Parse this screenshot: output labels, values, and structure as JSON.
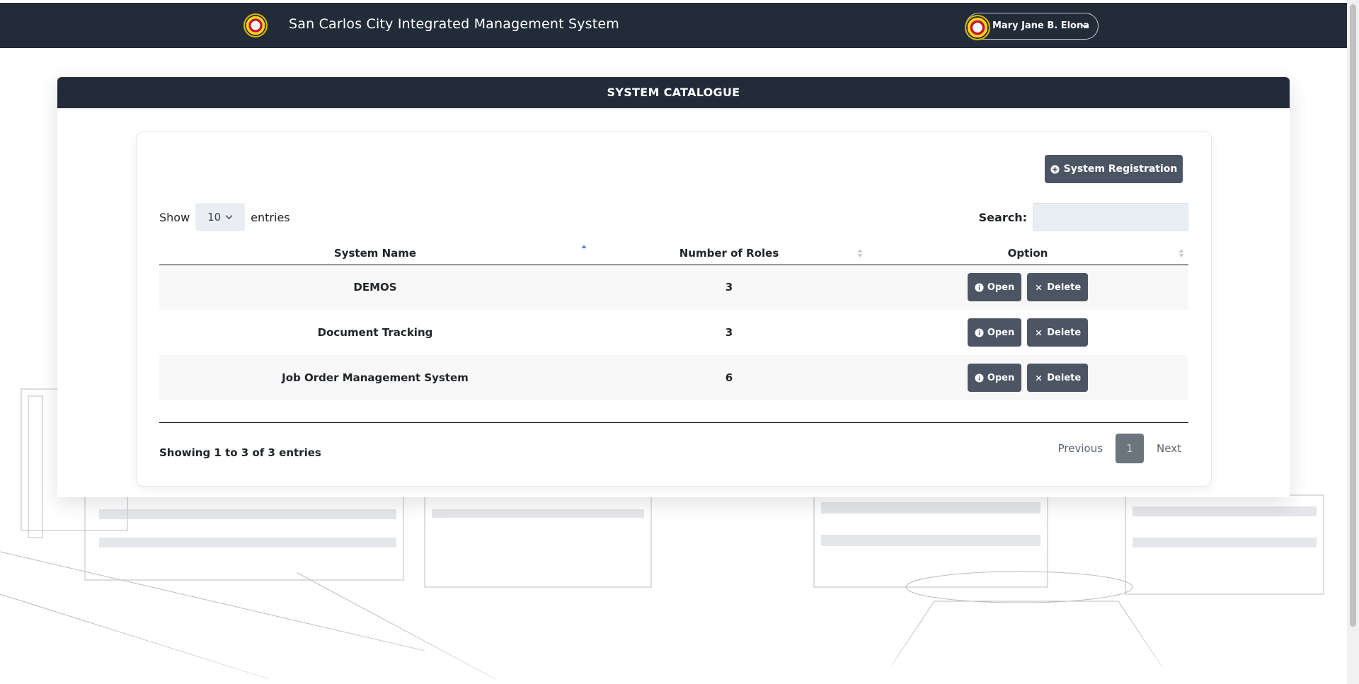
{
  "navbar": {
    "title": "San Carlos City Integrated Management System",
    "user_name": "Mary Jane B. Elona"
  },
  "card": {
    "header": "SYSTEM CATALOGUE",
    "register_button": "System Registration"
  },
  "table_controls": {
    "show_label": "Show",
    "entries_value": "10",
    "entries_label": "entries",
    "search_label": "Search:",
    "search_value": ""
  },
  "table": {
    "columns": [
      "System Name",
      "Number of Roles",
      "Option"
    ],
    "rows": [
      {
        "name": "DEMOS",
        "roles": "3"
      },
      {
        "name": "Document Tracking",
        "roles": "3"
      },
      {
        "name": "Job Order Management System",
        "roles": "6"
      }
    ],
    "open_label": "Open",
    "delete_label": "Delete"
  },
  "footer": {
    "info": "Showing 1 to 3 of 3 entries",
    "previous": "Previous",
    "current_page": "1",
    "next": "Next"
  },
  "colors": {
    "navbar": "#222b38",
    "button": "#4c5563",
    "sort_active": "#5b7fd6"
  }
}
